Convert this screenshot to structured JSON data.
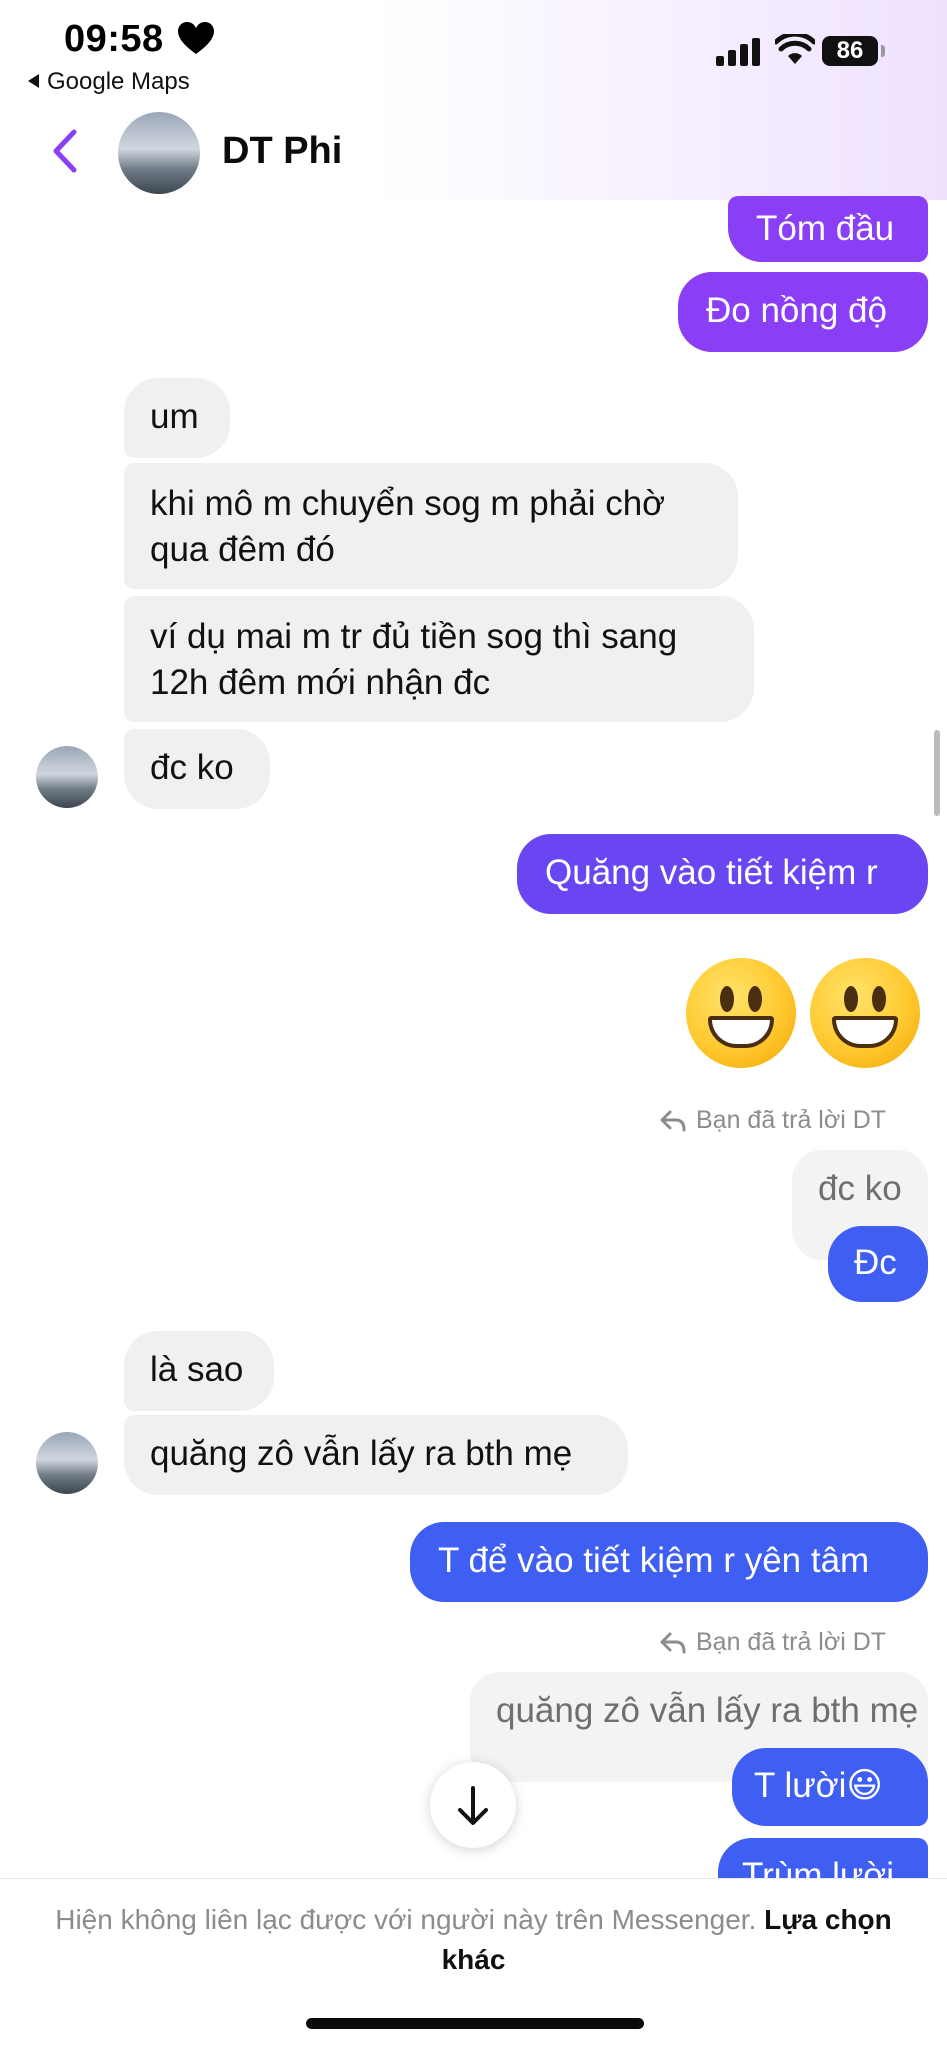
{
  "status_bar": {
    "time": "09:58",
    "back_app": "Google Maps",
    "battery": "86"
  },
  "header": {
    "contact_name": "DT Phi"
  },
  "messages": [
    {
      "text": "Tóm đầu",
      "dir": "out"
    },
    {
      "text": "Đo nồng độ",
      "dir": "out"
    },
    {
      "text": "um",
      "dir": "in"
    },
    {
      "text_lines": [
        "khi mô m chuyển sog m phải chờ",
        "qua đêm đó"
      ],
      "dir": "in"
    },
    {
      "text_lines": [
        "ví dụ mai m tr đủ tiền sog thì sang",
        "12h đêm mới nhận đc"
      ],
      "dir": "in"
    },
    {
      "text": "đc ko",
      "dir": "in"
    },
    {
      "text": "Quăng vào tiết kiệm r",
      "dir": "out"
    },
    {
      "emoji": "smiley-emoji x2",
      "dir": "out"
    },
    {
      "reply_note": "Bạn đã trả lời DT",
      "quoted": "đc ko",
      "text": "Đc",
      "dir": "out"
    },
    {
      "text": "là sao",
      "dir": "in"
    },
    {
      "text": "quăng zô vẫn lấy ra bth mẹ",
      "dir": "in"
    },
    {
      "text": "T để vào tiết kiệm r yên tâm",
      "dir": "out"
    },
    {
      "reply_note": "Bạn đã trả lời DT",
      "quoted": "quăng zô vẫn lấy ra bth mẹ",
      "text": "T lười😃",
      "dir": "out"
    },
    {
      "text": "Trùm lười",
      "dir": "out"
    }
  ],
  "footer": {
    "notice": "Hiện không liên lạc được với người này trên Messenger.",
    "link": "Lựa chọn khác"
  },
  "icons": {
    "heart": "heart-icon",
    "signal": "signal-icon",
    "wifi": "wifi-icon",
    "back": "chevron-left-icon",
    "reply": "reply-arrow-icon",
    "scroll": "arrow-down-icon"
  },
  "colors": {
    "accent_purple": "#8a3ef5",
    "accent_violet": "#6a46f2",
    "accent_blue": "#3f5ef2",
    "incoming_bg": "#f0f0f1"
  }
}
